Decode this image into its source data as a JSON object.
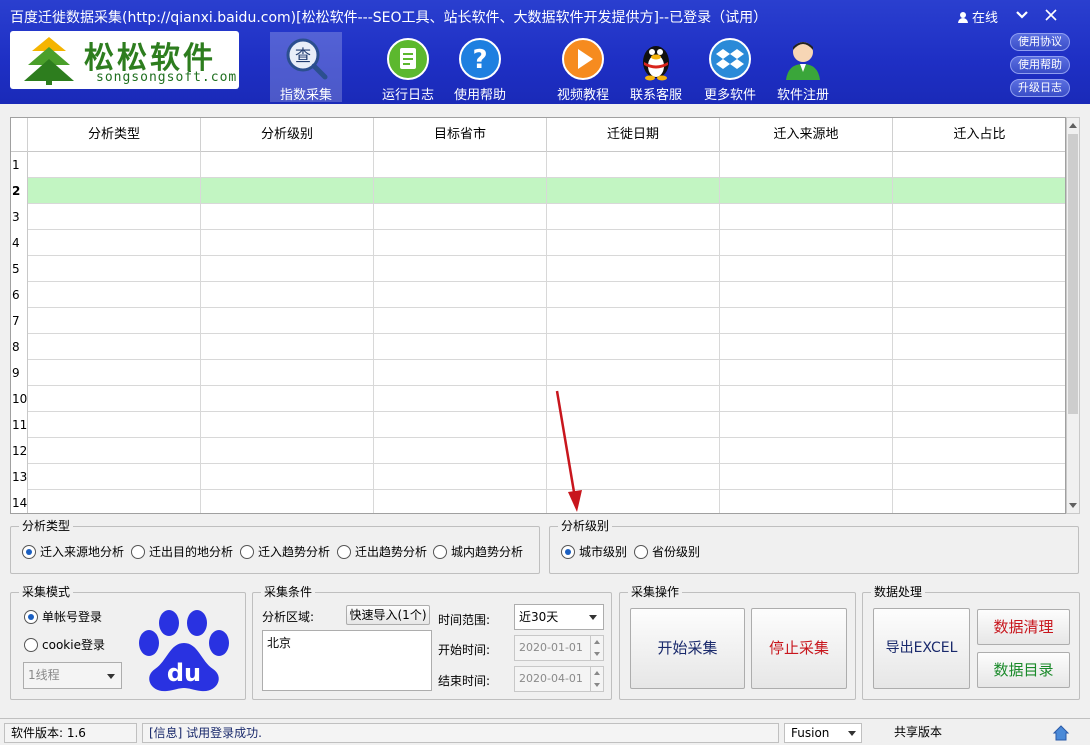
{
  "window": {
    "title": "百度迁徙数据采集(http://qianxi.baidu.com)[松松软件---SEO工具、站长软件、大数据软件开发提供方]--已登录（试用）",
    "status": "在线"
  },
  "logo": {
    "name": "松松软件",
    "domain": "songsongsoft.com"
  },
  "toolbar": {
    "items": [
      {
        "label": "指数采集",
        "icon": "search-icon"
      },
      {
        "label": "运行日志",
        "icon": "log-icon"
      },
      {
        "label": "使用帮助",
        "icon": "help-icon"
      },
      {
        "label": "视频教程",
        "icon": "play-icon"
      },
      {
        "label": "联系客服",
        "icon": "qq-penguin-icon"
      },
      {
        "label": "更多软件",
        "icon": "dropbox-icon"
      },
      {
        "label": "软件注册",
        "icon": "user-icon"
      }
    ]
  },
  "side_buttons": [
    "使用协议",
    "使用帮助",
    "升级日志"
  ],
  "grid": {
    "columns": [
      "分析类型",
      "分析级别",
      "目标省市",
      "迁徙日期",
      "迁入来源地",
      "迁入占比"
    ],
    "row_numbers": [
      "1",
      "2",
      "3",
      "4",
      "5",
      "6",
      "7",
      "8",
      "9",
      "10",
      "11",
      "12",
      "13",
      "14"
    ],
    "selected_row": "2"
  },
  "analysis_type": {
    "title": "分析类型",
    "options": [
      "迁入来源地分析",
      "迁出目的地分析",
      "迁入趋势分析",
      "迁出趋势分析",
      "城内趋势分析"
    ],
    "selected": "迁入来源地分析"
  },
  "analysis_level": {
    "title": "分析级别",
    "options": [
      "城市级别",
      "省份级别"
    ],
    "selected": "城市级别"
  },
  "collect_mode": {
    "title": "采集模式",
    "options": [
      "单帐号登录",
      "cookie登录"
    ],
    "selected": "单帐号登录",
    "thread_value": "1线程",
    "brand_text": "du"
  },
  "conditions": {
    "title": "采集条件",
    "area_label": "分析区域:",
    "quick_import": "快速导入(1个)",
    "area_value": "北京",
    "range_label": "时间范围:",
    "range_value": "近30天",
    "start_label": "开始时间:",
    "start_value": "2020-01-01",
    "end_label": "结束时间:",
    "end_value": "2020-04-01"
  },
  "operations": {
    "title": "采集操作",
    "start": "开始采集",
    "stop": "停止采集"
  },
  "data_processing": {
    "title": "数据处理",
    "export": "导出EXCEL",
    "clean": "数据清理",
    "dir": "数据目录"
  },
  "statusbar": {
    "version": "软件版本: 1.6",
    "message": "[信息] 试用登录成功.",
    "theme": "Fusion",
    "edition": "共享版本"
  },
  "colors": {
    "title_bar": "#1e2fc4",
    "selected_row": "#c2f5c2",
    "stop_text": "#c8161d",
    "clean_text": "#c8161d",
    "dir_text": "#1a8a2a",
    "accent_radio": "#1b5fc1"
  }
}
